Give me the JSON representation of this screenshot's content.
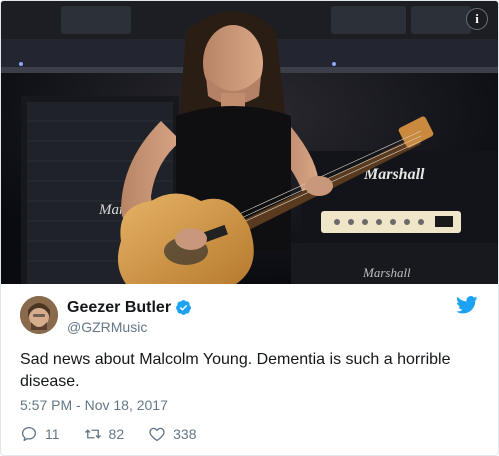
{
  "tweet": {
    "info_icon": "info-icon",
    "author": {
      "name": "Geezer Butler",
      "handle": "@GZRMusic",
      "verified_icon": "verified-badge-icon"
    },
    "logo_icon": "twitter-bird-icon",
    "text": "Sad news about Malcolm Young. Dementia is such a horrible disease.",
    "timestamp": "5:57 PM - Nov 18, 2017",
    "actions": {
      "replies": "11",
      "retweets": "82",
      "likes": "338"
    },
    "colors": {
      "accent": "#1da1f2",
      "secondary_text": "#657786",
      "border": "#e1e8ed"
    }
  },
  "photo": {
    "amp_brand_top": "Marshall",
    "amp_brand_bottom": "Marshall",
    "amp_brand_left": "Marshall"
  }
}
